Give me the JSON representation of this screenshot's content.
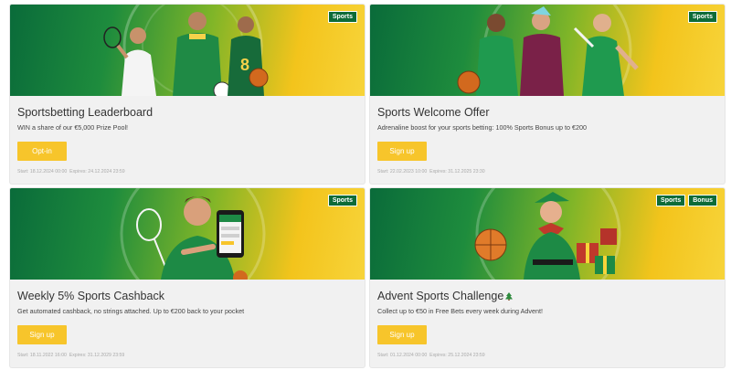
{
  "cards": [
    {
      "tags": [
        "Sports"
      ],
      "title": "Sportsbetting Leaderboard",
      "description": "WIN a share of our €5,000 Prize Pool!",
      "button": "Opt-in",
      "start": "Start: 18.12.2024 00:00",
      "expires": "Expires: 24.12.2024 23:59"
    },
    {
      "tags": [
        "Sports"
      ],
      "title": "Sports Welcome Offer",
      "description": "Adrenaline boost for your sports betting: 100% Sports Bonus up to €200",
      "button": "Sign up",
      "start": "Start: 22.02.2023 10:00",
      "expires": "Expires: 31.12.2025 23:30"
    },
    {
      "tags": [
        "Sports"
      ],
      "title": "Weekly 5% Sports Cashback",
      "description": "Get automated cashback, no strings attached. Up to €200 back to your pocket",
      "button": "Sign up",
      "start": "Start: 18.11.2022 16:00",
      "expires": "Expires: 31.12.2029 23:59"
    },
    {
      "tags": [
        "Sports",
        "Bonus"
      ],
      "title": "Advent Sports Challenge",
      "description": "Collect up to €50 in Free Bets every week during Advent!",
      "button": "Sign up",
      "start": "Start: 01.12.2024 00:00",
      "expires": "Expires: 25.12.2024 23:59"
    }
  ],
  "colors": {
    "tag_bg": "#0d6b37",
    "button_bg": "#f7c52b",
    "banner_green": "#1e8c3d",
    "banner_yellow": "#f3c41c"
  }
}
